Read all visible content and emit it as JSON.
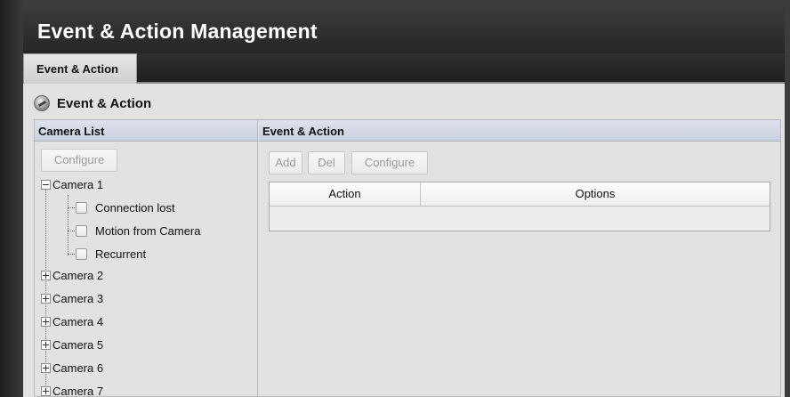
{
  "app": {
    "title": "Event & Action Management"
  },
  "tabs": [
    {
      "label": "Event & Action"
    }
  ],
  "section": {
    "title": "Event & Action",
    "icon": "gauge-icon"
  },
  "left_panel": {
    "header": "Camera List",
    "configure_label": "Configure",
    "cameras": [
      {
        "label": "Camera 1",
        "expanded": true,
        "events": [
          {
            "label": "Connection lost"
          },
          {
            "label": "Motion from Camera"
          },
          {
            "label": "Recurrent"
          }
        ]
      },
      {
        "label": "Camera 2",
        "expanded": false
      },
      {
        "label": "Camera 3",
        "expanded": false
      },
      {
        "label": "Camera 4",
        "expanded": false
      },
      {
        "label": "Camera 5",
        "expanded": false
      },
      {
        "label": "Camera 6",
        "expanded": false
      },
      {
        "label": "Camera 7",
        "expanded": false
      }
    ]
  },
  "right_panel": {
    "header": "Event & Action",
    "toolbar": {
      "add_label": "Add",
      "del_label": "Del",
      "configure_label": "Configure"
    },
    "table": {
      "columns": [
        "Action",
        "Options"
      ],
      "rows": []
    }
  },
  "colors": {
    "header_bg": "#2f2f2f",
    "panel_head_bg": "#d2d8e4",
    "content_bg": "#e2e2e2"
  }
}
